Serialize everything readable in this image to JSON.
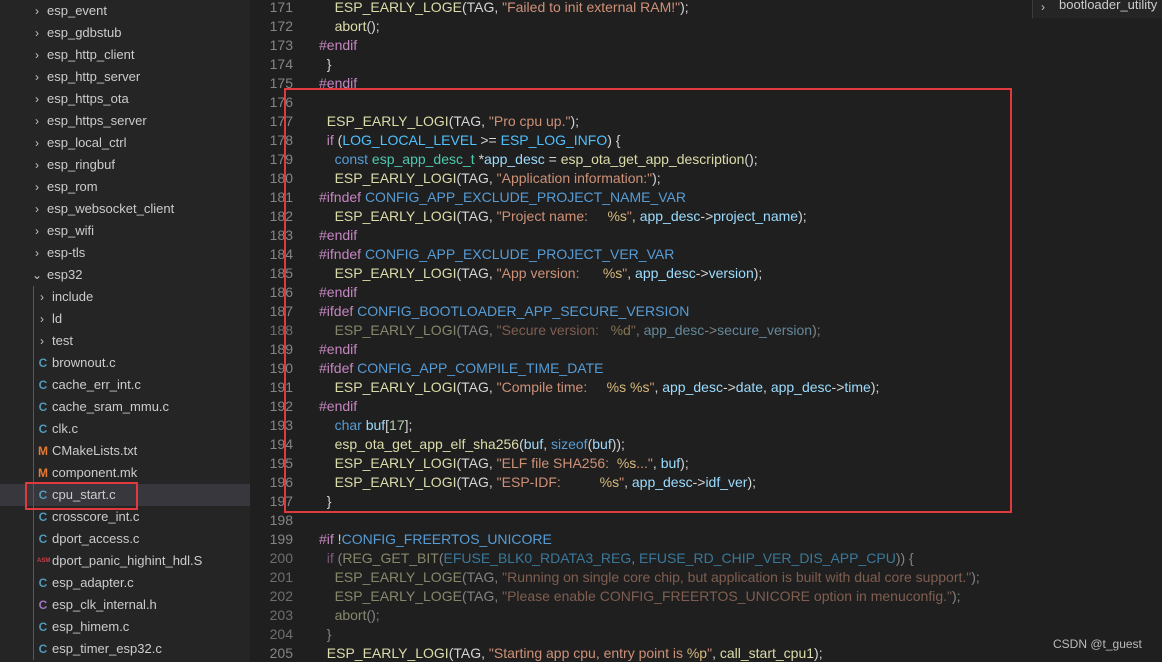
{
  "explorer": {
    "items": [
      {
        "label": "esp_event",
        "kind": "folder",
        "indent": 0,
        "expanded": false
      },
      {
        "label": "esp_gdbstub",
        "kind": "folder",
        "indent": 0,
        "expanded": false
      },
      {
        "label": "esp_http_client",
        "kind": "folder",
        "indent": 0,
        "expanded": false
      },
      {
        "label": "esp_http_server",
        "kind": "folder",
        "indent": 0,
        "expanded": false
      },
      {
        "label": "esp_https_ota",
        "kind": "folder",
        "indent": 0,
        "expanded": false
      },
      {
        "label": "esp_https_server",
        "kind": "folder",
        "indent": 0,
        "expanded": false
      },
      {
        "label": "esp_local_ctrl",
        "kind": "folder",
        "indent": 0,
        "expanded": false
      },
      {
        "label": "esp_ringbuf",
        "kind": "folder",
        "indent": 0,
        "expanded": false
      },
      {
        "label": "esp_rom",
        "kind": "folder",
        "indent": 0,
        "expanded": false
      },
      {
        "label": "esp_websocket_client",
        "kind": "folder",
        "indent": 0,
        "expanded": false
      },
      {
        "label": "esp_wifi",
        "kind": "folder",
        "indent": 0,
        "expanded": false
      },
      {
        "label": "esp-tls",
        "kind": "folder",
        "indent": 0,
        "expanded": false
      },
      {
        "label": "esp32",
        "kind": "folder",
        "indent": 0,
        "expanded": true
      },
      {
        "label": "include",
        "kind": "folder",
        "indent": 1,
        "expanded": false
      },
      {
        "label": "ld",
        "kind": "folder",
        "indent": 1,
        "expanded": false
      },
      {
        "label": "test",
        "kind": "folder",
        "indent": 1,
        "expanded": false
      },
      {
        "label": "brownout.c",
        "kind": "c",
        "indent": 1
      },
      {
        "label": "cache_err_int.c",
        "kind": "c",
        "indent": 1
      },
      {
        "label": "cache_sram_mmu.c",
        "kind": "c",
        "indent": 1
      },
      {
        "label": "clk.c",
        "kind": "c",
        "indent": 1
      },
      {
        "label": "CMakeLists.txt",
        "kind": "m",
        "indent": 1
      },
      {
        "label": "component.mk",
        "kind": "m",
        "indent": 1
      },
      {
        "label": "cpu_start.c",
        "kind": "c",
        "indent": 1,
        "selected": true
      },
      {
        "label": "crosscore_int.c",
        "kind": "c",
        "indent": 1
      },
      {
        "label": "dport_access.c",
        "kind": "c",
        "indent": 1
      },
      {
        "label": "dport_panic_highint_hdl.S",
        "kind": "s",
        "indent": 1
      },
      {
        "label": "esp_adapter.c",
        "kind": "c",
        "indent": 1
      },
      {
        "label": "esp_clk_internal.h",
        "kind": "h",
        "indent": 1
      },
      {
        "label": "esp_himem.c",
        "kind": "c",
        "indent": 1
      },
      {
        "label": "esp_timer_esp32.c",
        "kind": "c",
        "indent": 1
      }
    ],
    "icon_glyphs": {
      "c": "C",
      "h": "C",
      "m": "M",
      "s": "ASM"
    },
    "chevron_collapsed": "›",
    "chevron_expanded": "⌄"
  },
  "sticky_scroll": {
    "label": "bootloader_utility",
    "chevron": "›"
  },
  "editor": {
    "lines": [
      {
        "n": "171",
        "dim": false,
        "t": [
          [
            "    ",
            ""
          ],
          [
            "ESP_EARLY_LOGE",
            "fn"
          ],
          [
            "(TAG, ",
            ""
          ],
          [
            "\"Failed to init external RAM!\"",
            "str"
          ],
          [
            ");",
            ""
          ]
        ]
      },
      {
        "n": "172",
        "dim": false,
        "t": [
          [
            "    ",
            ""
          ],
          [
            "abort",
            "fn"
          ],
          [
            "();",
            ""
          ]
        ]
      },
      {
        "n": "173",
        "dim": false,
        "t": [
          [
            "#endif",
            "pp"
          ]
        ]
      },
      {
        "n": "174",
        "dim": false,
        "t": [
          [
            "  }",
            ""
          ]
        ]
      },
      {
        "n": "175",
        "dim": false,
        "t": [
          [
            "#endif",
            "pp"
          ]
        ]
      },
      {
        "n": "176",
        "dim": false,
        "t": []
      },
      {
        "n": "177",
        "dim": false,
        "t": [
          [
            "  ",
            ""
          ],
          [
            "ESP_EARLY_LOGI",
            "fn"
          ],
          [
            "(TAG, ",
            ""
          ],
          [
            "\"Pro cpu up.\"",
            "str"
          ],
          [
            ");",
            ""
          ]
        ]
      },
      {
        "n": "178",
        "dim": false,
        "t": [
          [
            "  ",
            ""
          ],
          [
            "if",
            "ctl"
          ],
          [
            " (",
            ""
          ],
          [
            "LOG_LOCAL_LEVEL",
            "mac"
          ],
          [
            " >= ",
            ""
          ],
          [
            "ESP_LOG_INFO",
            "mac"
          ],
          [
            ") {",
            ""
          ]
        ]
      },
      {
        "n": "179",
        "dim": false,
        "t": [
          [
            "    ",
            ""
          ],
          [
            "const",
            "kw"
          ],
          [
            " ",
            ""
          ],
          [
            "esp_app_desc_t",
            "typ"
          ],
          [
            " *",
            ""
          ],
          [
            "app_desc",
            "var"
          ],
          [
            " = ",
            ""
          ],
          [
            "esp_ota_get_app_description",
            "fn"
          ],
          [
            "();",
            ""
          ]
        ]
      },
      {
        "n": "180",
        "dim": false,
        "t": [
          [
            "    ",
            ""
          ],
          [
            "ESP_EARLY_LOGI",
            "fn"
          ],
          [
            "(TAG, ",
            ""
          ],
          [
            "\"Application information:\"",
            "str"
          ],
          [
            ");",
            ""
          ]
        ]
      },
      {
        "n": "181",
        "dim": false,
        "t": [
          [
            "#ifndef",
            "pp"
          ],
          [
            " ",
            ""
          ],
          [
            "CONFIG_APP_EXCLUDE_PROJECT_NAME_VAR",
            "ppn"
          ]
        ]
      },
      {
        "n": "182",
        "dim": false,
        "t": [
          [
            "    ",
            ""
          ],
          [
            "ESP_EARLY_LOGI",
            "fn"
          ],
          [
            "(TAG, ",
            ""
          ],
          [
            "\"Project name:     ",
            "str"
          ],
          [
            "%s",
            "esc"
          ],
          [
            "\"",
            "str"
          ],
          [
            ", ",
            ""
          ],
          [
            "app_desc",
            "var"
          ],
          [
            "->",
            ""
          ],
          [
            "project_name",
            "var"
          ],
          [
            ");",
            ""
          ]
        ]
      },
      {
        "n": "183",
        "dim": false,
        "t": [
          [
            "#endif",
            "pp"
          ]
        ]
      },
      {
        "n": "184",
        "dim": false,
        "t": [
          [
            "#ifndef",
            "pp"
          ],
          [
            " ",
            ""
          ],
          [
            "CONFIG_APP_EXCLUDE_PROJECT_VER_VAR",
            "ppn"
          ]
        ]
      },
      {
        "n": "185",
        "dim": false,
        "t": [
          [
            "    ",
            ""
          ],
          [
            "ESP_EARLY_LOGI",
            "fn"
          ],
          [
            "(TAG, ",
            ""
          ],
          [
            "\"App version:      ",
            "str"
          ],
          [
            "%s",
            "esc"
          ],
          [
            "\"",
            "str"
          ],
          [
            ", ",
            ""
          ],
          [
            "app_desc",
            "var"
          ],
          [
            "->",
            ""
          ],
          [
            "version",
            "var"
          ],
          [
            ");",
            ""
          ]
        ]
      },
      {
        "n": "186",
        "dim": false,
        "t": [
          [
            "#endif",
            "pp"
          ]
        ]
      },
      {
        "n": "187",
        "dim": false,
        "t": [
          [
            "#ifdef",
            "pp"
          ],
          [
            " ",
            ""
          ],
          [
            "CONFIG_BOOTLOADER_APP_SECURE_VERSION",
            "ppn"
          ]
        ]
      },
      {
        "n": "188",
        "dim": true,
        "t": [
          [
            "    ",
            ""
          ],
          [
            "ESP_EARLY_LOGI",
            "fn"
          ],
          [
            "(TAG, ",
            ""
          ],
          [
            "\"Secure version:   ",
            "str"
          ],
          [
            "%d",
            "esc"
          ],
          [
            "\"",
            "str"
          ],
          [
            ", ",
            ""
          ],
          [
            "app_desc",
            "var"
          ],
          [
            "->",
            ""
          ],
          [
            "secure_version",
            "var"
          ],
          [
            ");",
            ""
          ]
        ]
      },
      {
        "n": "189",
        "dim": false,
        "t": [
          [
            "#endif",
            "pp"
          ]
        ]
      },
      {
        "n": "190",
        "dim": false,
        "t": [
          [
            "#ifdef",
            "pp"
          ],
          [
            " ",
            ""
          ],
          [
            "CONFIG_APP_COMPILE_TIME_DATE",
            "ppn"
          ]
        ]
      },
      {
        "n": "191",
        "dim": false,
        "t": [
          [
            "    ",
            ""
          ],
          [
            "ESP_EARLY_LOGI",
            "fn"
          ],
          [
            "(TAG, ",
            ""
          ],
          [
            "\"Compile time:     ",
            "str"
          ],
          [
            "%s %s",
            "esc"
          ],
          [
            "\"",
            "str"
          ],
          [
            ", ",
            ""
          ],
          [
            "app_desc",
            "var"
          ],
          [
            "->",
            ""
          ],
          [
            "date",
            "var"
          ],
          [
            ", ",
            ""
          ],
          [
            "app_desc",
            "var"
          ],
          [
            "->",
            ""
          ],
          [
            "time",
            "var"
          ],
          [
            ");",
            ""
          ]
        ]
      },
      {
        "n": "192",
        "dim": false,
        "t": [
          [
            "#endif",
            "pp"
          ]
        ]
      },
      {
        "n": "193",
        "dim": false,
        "t": [
          [
            "    ",
            ""
          ],
          [
            "char",
            "kw"
          ],
          [
            " ",
            ""
          ],
          [
            "buf",
            "var"
          ],
          [
            "[",
            ""
          ],
          [
            "17",
            "num"
          ],
          [
            "];",
            ""
          ]
        ]
      },
      {
        "n": "194",
        "dim": false,
        "t": [
          [
            "    ",
            ""
          ],
          [
            "esp_ota_get_app_elf_sha256",
            "fn"
          ],
          [
            "(",
            ""
          ],
          [
            "buf",
            "var"
          ],
          [
            ", ",
            ""
          ],
          [
            "sizeof",
            "kw"
          ],
          [
            "(",
            ""
          ],
          [
            "buf",
            "var"
          ],
          [
            "));",
            ""
          ]
        ]
      },
      {
        "n": "195",
        "dim": false,
        "t": [
          [
            "    ",
            ""
          ],
          [
            "ESP_EARLY_LOGI",
            "fn"
          ],
          [
            "(TAG, ",
            ""
          ],
          [
            "\"ELF file SHA256:  ",
            "str"
          ],
          [
            "%s",
            "esc"
          ],
          [
            "...\"",
            "str"
          ],
          [
            ", ",
            ""
          ],
          [
            "buf",
            "var"
          ],
          [
            ");",
            ""
          ]
        ]
      },
      {
        "n": "196",
        "dim": false,
        "t": [
          [
            "    ",
            ""
          ],
          [
            "ESP_EARLY_LOGI",
            "fn"
          ],
          [
            "(TAG, ",
            ""
          ],
          [
            "\"ESP-IDF:          ",
            "str"
          ],
          [
            "%s",
            "esc"
          ],
          [
            "\"",
            "str"
          ],
          [
            ", ",
            ""
          ],
          [
            "app_desc",
            "var"
          ],
          [
            "->",
            ""
          ],
          [
            "idf_ver",
            "var"
          ],
          [
            ");",
            ""
          ]
        ]
      },
      {
        "n": "197",
        "dim": false,
        "t": [
          [
            "  }",
            ""
          ]
        ]
      },
      {
        "n": "198",
        "dim": false,
        "t": []
      },
      {
        "n": "199",
        "dim": false,
        "t": [
          [
            "#if",
            "pp"
          ],
          [
            " !",
            ""
          ],
          [
            "CONFIG_FREERTOS_UNICORE",
            "ppn"
          ]
        ]
      },
      {
        "n": "200",
        "dim": true,
        "t": [
          [
            "  ",
            ""
          ],
          [
            "if",
            "ctl"
          ],
          [
            " (",
            ""
          ],
          [
            "REG_GET_BIT",
            "fn"
          ],
          [
            "(",
            ""
          ],
          [
            "EFUSE_BLK0_RDATA3_REG",
            "mac"
          ],
          [
            ", ",
            ""
          ],
          [
            "EFUSE_RD_CHIP_VER_DIS_APP_CPU",
            "mac"
          ],
          [
            ")) {",
            ""
          ]
        ]
      },
      {
        "n": "201",
        "dim": true,
        "t": [
          [
            "    ",
            ""
          ],
          [
            "ESP_EARLY_LOGE",
            "fn"
          ],
          [
            "(TAG, ",
            ""
          ],
          [
            "\"Running on single core chip, but application is built with dual core support.\"",
            "str"
          ],
          [
            ");",
            ""
          ]
        ]
      },
      {
        "n": "202",
        "dim": true,
        "t": [
          [
            "    ",
            ""
          ],
          [
            "ESP_EARLY_LOGE",
            "fn"
          ],
          [
            "(TAG, ",
            ""
          ],
          [
            "\"Please enable CONFIG_FREERTOS_UNICORE option in menuconfig.\"",
            "str"
          ],
          [
            ");",
            ""
          ]
        ]
      },
      {
        "n": "203",
        "dim": true,
        "t": [
          [
            "    ",
            ""
          ],
          [
            "abort",
            "fn"
          ],
          [
            "();",
            ""
          ]
        ]
      },
      {
        "n": "204",
        "dim": true,
        "t": [
          [
            "  }",
            ""
          ]
        ]
      },
      {
        "n": "205",
        "dim": false,
        "t": [
          [
            "  ",
            ""
          ],
          [
            "ESP_EARLY_LOGI",
            "fn"
          ],
          [
            "(TAG, ",
            ""
          ],
          [
            "\"Starting app cpu, entry point is ",
            "str"
          ],
          [
            "%p",
            "esc"
          ],
          [
            "\"",
            "str"
          ],
          [
            ", ",
            ""
          ],
          [
            "call_start_cpu1",
            "fn"
          ],
          [
            ");",
            ""
          ]
        ]
      }
    ]
  },
  "watermark": "CSDN @t_guest"
}
